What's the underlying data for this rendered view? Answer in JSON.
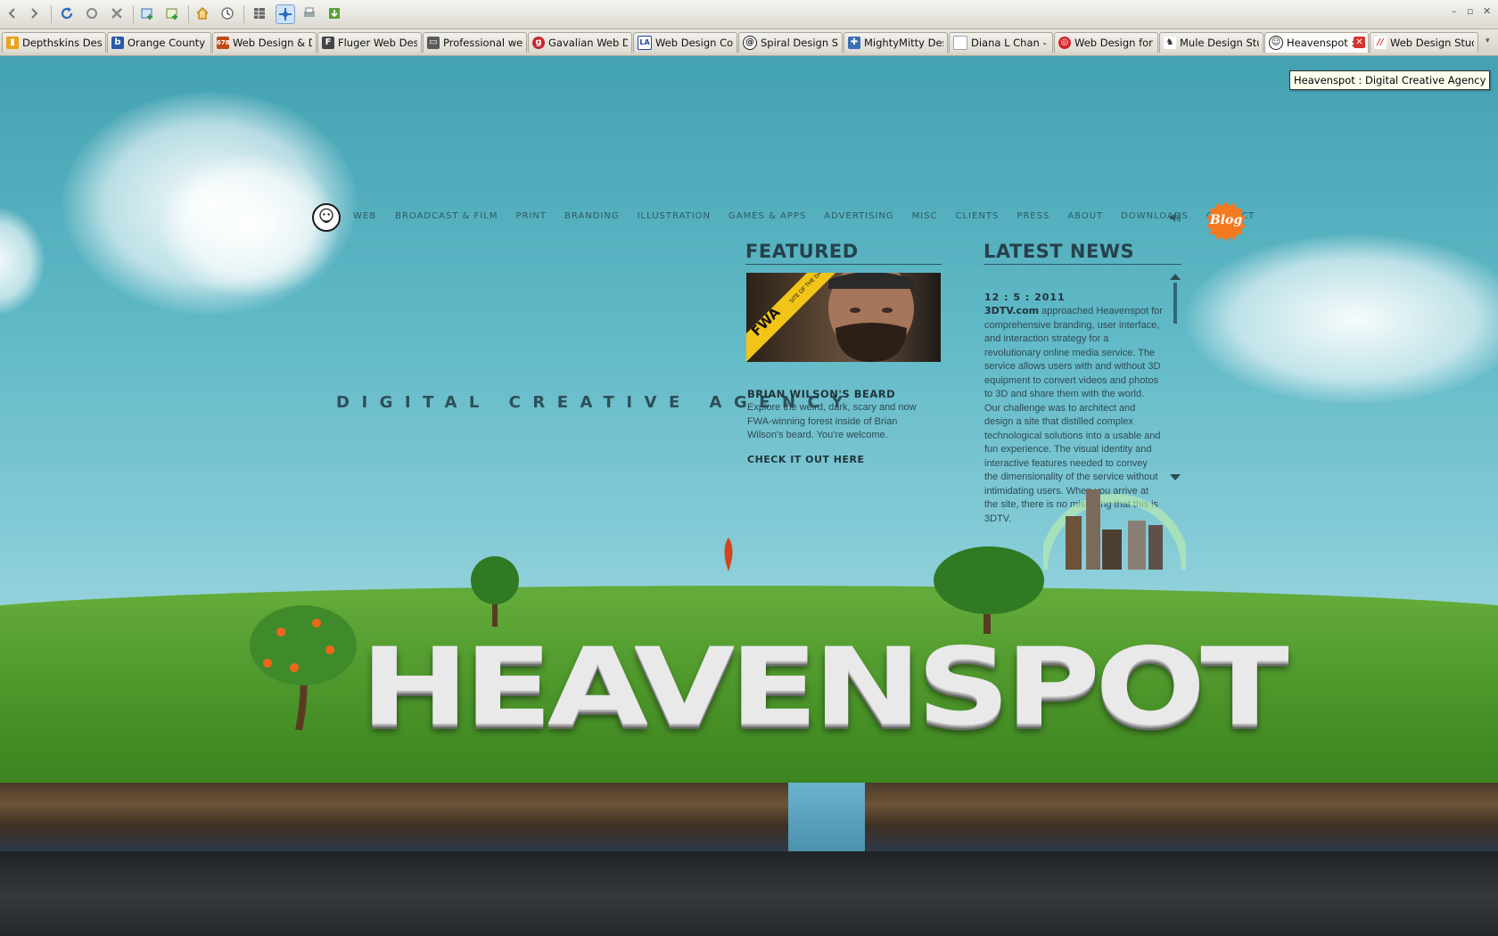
{
  "browser": {
    "tabs": [
      {
        "label": "Depthskins Desig...",
        "favicon": "flame-icon",
        "color": "#e8a21c"
      },
      {
        "label": "Orange County ...",
        "favicon": "b-icon",
        "color": "#2a5aa6"
      },
      {
        "label": "Web Design & D...",
        "favicon": "678-icon",
        "color": "#c04a14"
      },
      {
        "label": "Fluger Web Desi...",
        "favicon": "f-icon",
        "color": "#444444"
      },
      {
        "label": "Professional web...",
        "favicon": "monitor-icon",
        "color": "#5a5a5a"
      },
      {
        "label": "Gavalian Web De...",
        "favicon": "g-icon",
        "color": "#c4262e"
      },
      {
        "label": "Web Design Com...",
        "favicon": "la-icon",
        "color": "#1d4aa0"
      },
      {
        "label": "Spiral Design Stu...",
        "favicon": "spiral-icon",
        "color": "#222222"
      },
      {
        "label": "MightyMitty Desi...",
        "favicon": "puzzle-icon",
        "color": "#3a6fb5"
      },
      {
        "label": "Diana L Chan - F...",
        "favicon": "page-icon",
        "color": "#9aa4b3"
      },
      {
        "label": "Web Design for ...",
        "favicon": "target-icon",
        "color": "#d4232a"
      },
      {
        "label": "Mule Design Studio",
        "favicon": "mule-icon",
        "color": "#333333"
      },
      {
        "label": "Heavenspot : ...",
        "favicon": "heavenspot-icon",
        "color": "#222222",
        "active": true
      },
      {
        "label": "Web Design Stud...",
        "favicon": "slash-icon",
        "color": "#d8332f"
      }
    ],
    "tooltip": "Heavenspot : Digital Creative Agency"
  },
  "site": {
    "nav": [
      "WEB",
      "BROADCAST & FILM",
      "PRINT",
      "BRANDING",
      "ILLUSTRATION",
      "GAMES & APPS",
      "ADVERTISING",
      "MISC",
      "CLIENTS",
      "PRESS",
      "ABOUT",
      "DOWNLOADS",
      "CONTACT"
    ],
    "blog_label": "Blog",
    "tagline": "DIGITAL CREATIVE AGENCY",
    "featured": {
      "heading": "FEATURED",
      "ribbon_logo": "FWA",
      "ribbon_text": "SITE OF THE DAY",
      "title": "BRIAN WILSON'S BEARD",
      "description": "Explore the weird, dark, scary and now FWA-winning forest inside of Brian Wilson's beard. You're welcome.",
      "link": "CHECK IT OUT HERE"
    },
    "news": {
      "heading": "LATEST NEWS",
      "date": "12 : 5 : 2011",
      "client": "3DTV.com",
      "body": "approached Heavenspot for comprehensive branding, user interface, and interaction strategy for a revolutionary online media service. The service allows users with and without 3D equipment to convert videos and photos to 3D and share them with the world. Our challenge was to architect and design a site that distilled complex technological solutions into a usable and fun experience. The visual identity and interactive features needed to convey the dimensionality of the service without intimidating users. When you arrive at the site, there is no mistaking that this is 3DTV."
    },
    "hero_word": "HEAVENSPOT"
  }
}
